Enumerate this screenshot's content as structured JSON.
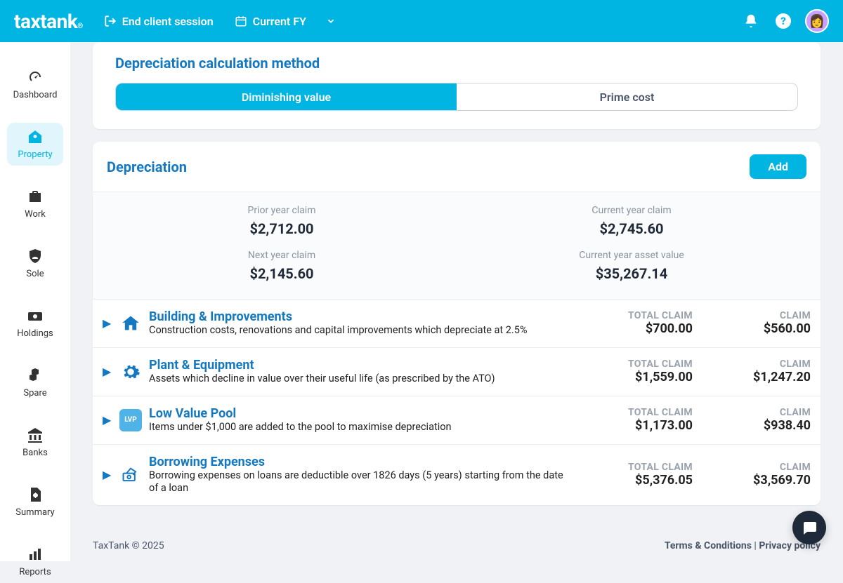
{
  "header": {
    "logo": "taxtank",
    "end_session": "End client session",
    "fy_label": "Current FY"
  },
  "sidebar": {
    "items": [
      {
        "label": "Dashboard"
      },
      {
        "label": "Property"
      },
      {
        "label": "Work"
      },
      {
        "label": "Sole"
      },
      {
        "label": "Holdings"
      },
      {
        "label": "Spare"
      },
      {
        "label": "Banks"
      },
      {
        "label": "Summary"
      },
      {
        "label": "Reports"
      }
    ]
  },
  "method": {
    "title": "Depreciation calculation method",
    "option_a": "Diminishing value",
    "option_b": "Prime cost"
  },
  "depreciation": {
    "title": "Depreciation",
    "add_label": "Add",
    "summary": {
      "prior_lbl": "Prior year claim",
      "prior_val": "$2,712.00",
      "current_lbl": "Current year claim",
      "current_val": "$2,745.60",
      "next_lbl": "Next year claim",
      "next_val": "$2,145.60",
      "asset_lbl": "Current year asset value",
      "asset_val": "$35,267.14"
    },
    "labels": {
      "total_claim": "TOTAL CLAIM",
      "claim": "CLAIM"
    },
    "categories": [
      {
        "title": "Building & Improvements",
        "desc": "Construction costs, renovations and capital improvements which depreciate at 2.5%",
        "total_claim": "$700.00",
        "claim": "$560.00"
      },
      {
        "title": "Plant & Equipment",
        "desc": "Assets which decline in value over their useful life (as prescribed by the ATO)",
        "total_claim": "$1,559.00",
        "claim": "$1,247.20"
      },
      {
        "title": "Low Value Pool",
        "desc": "Items under $1,000 are added to the pool to maximise depreciation",
        "total_claim": "$1,173.00",
        "claim": "$938.40"
      },
      {
        "title": "Borrowing Expenses",
        "desc": "Borrowing expenses on loans are deductible over 1826 days (5 years) starting from the date of a loan",
        "total_claim": "$5,376.05",
        "claim": "$3,569.70"
      }
    ]
  },
  "footer": {
    "copyright": "TaxTank © 2025",
    "terms": "Terms & Conditions",
    "sep": " | ",
    "privacy": "Privacy policy"
  }
}
